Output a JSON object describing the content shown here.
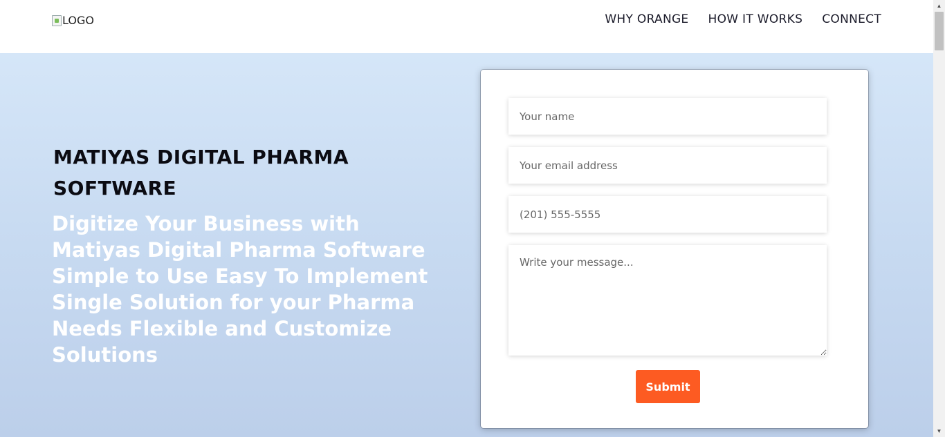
{
  "header": {
    "logo_alt": "LOGO",
    "nav": [
      {
        "label": "WHY ORANGE"
      },
      {
        "label": "HOW IT WORKS"
      },
      {
        "label": "CONNECT"
      }
    ]
  },
  "hero": {
    "title": "MATIYAS DIGITAL PHARMA SOFTWARE",
    "subtitle": "Digitize Your Business with Matiyas Digital Pharma Software Simple to Use Easy To Implement Single Solution for your Pharma Needs Flexible and Customize Solutions"
  },
  "form": {
    "name_placeholder": "Your name",
    "email_placeholder": "Your email address",
    "phone_placeholder": "(201) 555-5555",
    "message_placeholder": "Write your message...",
    "submit_label": "Submit"
  },
  "colors": {
    "accent": "#fd5b22",
    "hero_bg_top": "#d5e6f8",
    "hero_bg_bottom": "#bccfea"
  }
}
